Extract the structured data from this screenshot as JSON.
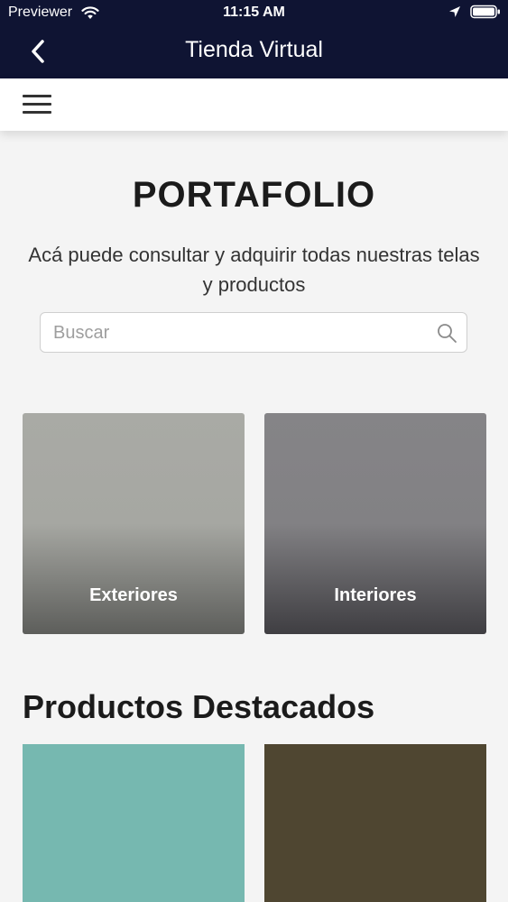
{
  "status_bar": {
    "carrier": "Previewer",
    "time": "11:15 AM",
    "icons": [
      "wifi-icon",
      "location-icon",
      "battery-icon"
    ]
  },
  "nav": {
    "title": "Tienda Virtual",
    "back_icon": "back-icon"
  },
  "menu": {
    "icon": "hamburger-icon"
  },
  "portfolio": {
    "title": "PORTAFOLIO",
    "subtitle": "Acá puede consultar y adquirir todas nuestras telas y productos"
  },
  "search": {
    "placeholder": "Buscar",
    "value": "",
    "icon": "search-icon"
  },
  "categories": [
    {
      "label": "Exteriores"
    },
    {
      "label": "Interiores"
    }
  ],
  "featured": {
    "title": "Productos Destacados",
    "products": [
      {
        "color": "#76b8b0"
      },
      {
        "color": "#4f4631"
      }
    ]
  },
  "colors": {
    "header_bg": "#0f1433",
    "page_bg": "#f4f4f4",
    "text_dark": "#1b1b1b"
  }
}
